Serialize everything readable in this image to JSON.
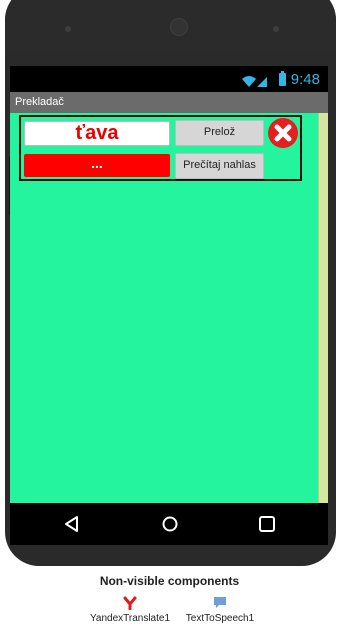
{
  "status_bar": {
    "time": "9:48",
    "accent_color": "#33b5e5"
  },
  "app": {
    "title": "Prekladač",
    "background_color": "#25f49f"
  },
  "form": {
    "input_text": "ťava",
    "output_text": "...",
    "translate_button": "Prelož",
    "speak_button": "Prečítaj nahlas",
    "clear_icon": "close-circle-icon"
  },
  "navigation": {
    "back_icon": "back-triangle-icon",
    "home_icon": "home-circle-icon",
    "recent_icon": "recent-square-icon"
  },
  "non_visible": {
    "title": "Non-visible components",
    "items": [
      {
        "label": "YandexTranslate1",
        "icon": "yandex-icon"
      },
      {
        "label": "TextToSpeech1",
        "icon": "speech-icon"
      }
    ]
  }
}
